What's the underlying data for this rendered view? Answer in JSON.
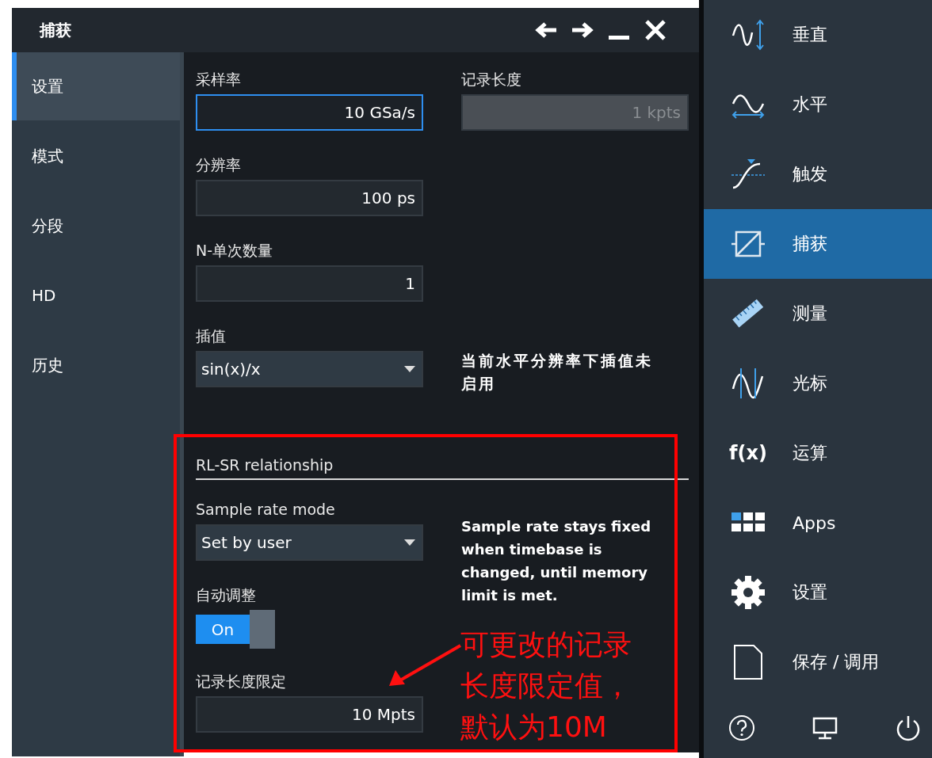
{
  "dialog": {
    "title": "捕获"
  },
  "tabs": [
    {
      "label": "设置",
      "selected": true
    },
    {
      "label": "模式",
      "selected": false
    },
    {
      "label": "分段",
      "selected": false
    },
    {
      "label": "HD",
      "selected": false
    },
    {
      "label": "历史",
      "selected": false
    }
  ],
  "left_fields": [
    {
      "label": "采样率",
      "value": "10 GSa/s",
      "kind": "input",
      "focused": true
    },
    {
      "label": "分辨率",
      "value": "100 ps",
      "kind": "input",
      "focused": false
    },
    {
      "label": "N-单次数量",
      "value": "1",
      "kind": "input",
      "focused": false
    },
    {
      "label": "插值",
      "value": "sin(x)/x",
      "kind": "dropdown",
      "focused": false
    }
  ],
  "record_length": {
    "label": "记录长度",
    "value": "1 kpts",
    "disabled": true
  },
  "interpolation_note": "当前水平分辨率下插值未启用",
  "rl_sr": {
    "title": "RL-SR relationship",
    "sample_rate_mode": {
      "label": "Sample rate mode",
      "value": "Set by user"
    },
    "note": "Sample rate stays fixed when timebase is changed, until memory limit is met.",
    "auto_adjust": {
      "label": "自动调整",
      "on": true,
      "text": "On"
    },
    "record_length_limit": {
      "label": "记录长度限定",
      "value": "10 Mpts"
    }
  },
  "annotation": {
    "text": "可更改的记录长度限定值，默认为10M"
  },
  "menu": {
    "items": [
      {
        "label": "垂直",
        "kind": "vertical",
        "selected": false
      },
      {
        "label": "水平",
        "kind": "horizontal",
        "selected": false
      },
      {
        "label": "触发",
        "kind": "trigger",
        "selected": false
      },
      {
        "label": "捕获",
        "kind": "acquire",
        "selected": true
      },
      {
        "label": "测量",
        "kind": "ruler",
        "selected": false
      },
      {
        "label": "光标",
        "kind": "cursor",
        "selected": false
      },
      {
        "label": "运算",
        "kind": "text",
        "icon_text": "f(x)",
        "selected": false
      },
      {
        "label": "Apps",
        "kind": "apps",
        "selected": false
      },
      {
        "label": "设置",
        "kind": "gear",
        "selected": false
      },
      {
        "label": "保存 / 调用",
        "kind": "file",
        "selected": false
      }
    ]
  }
}
